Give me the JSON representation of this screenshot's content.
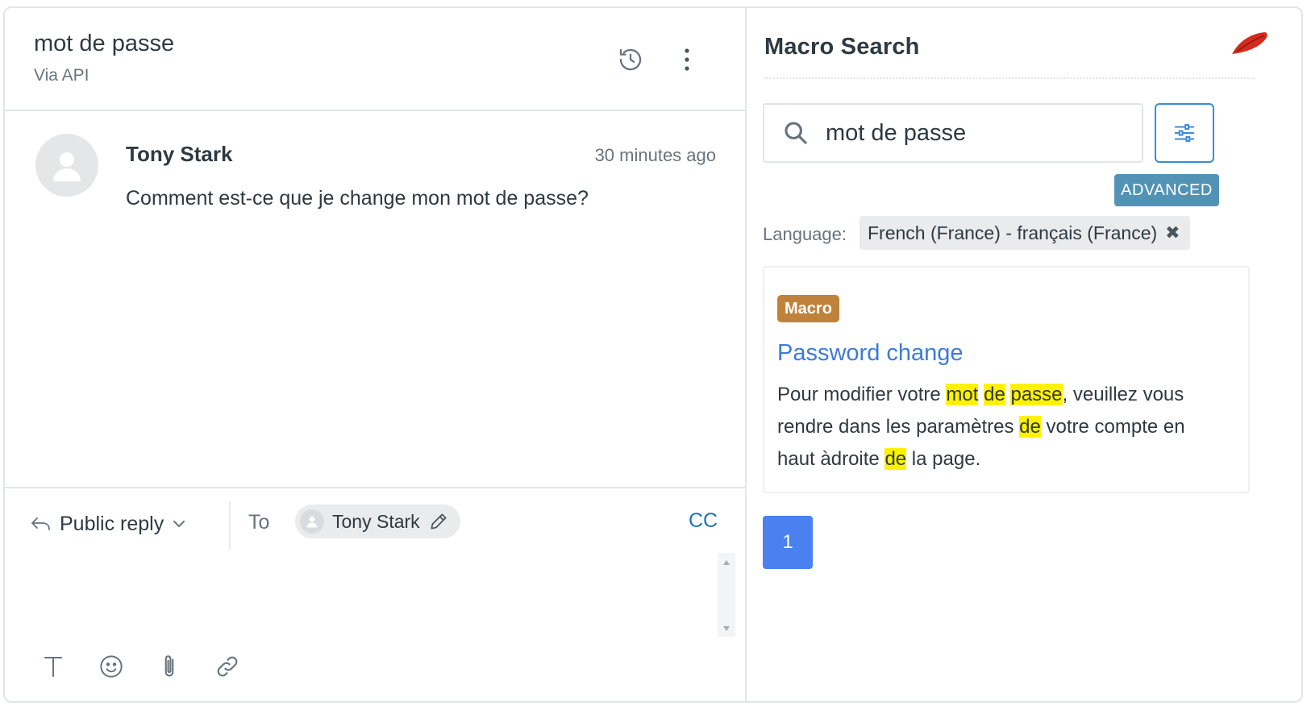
{
  "ticket": {
    "title": "mot de passe",
    "channel": "Via API",
    "message": {
      "author": "Tony Stark",
      "time": "30 minutes ago",
      "body": "Comment est-ce que je change mon mot de passe?"
    },
    "composer": {
      "reply_type": "Public reply",
      "to_label": "To",
      "recipient": "Tony Stark",
      "cc_label": "CC"
    }
  },
  "macro_search": {
    "title": "Macro Search",
    "query": "mot de passe",
    "advanced_label": "ADVANCED",
    "language_label": "Language:",
    "language_value": "French (France) - français (France)",
    "results": [
      {
        "type": "Macro",
        "title": "Password change",
        "snippet": [
          [
            "Pour modifier votre ",
            false
          ],
          [
            "mot",
            true
          ],
          [
            " ",
            false
          ],
          [
            "de",
            true
          ],
          [
            " ",
            false
          ],
          [
            "passe",
            true
          ],
          [
            ", veuillez vous rendre dans les paramètres ",
            false
          ],
          [
            "de",
            true
          ],
          [
            " votre compte en haut àdroite ",
            false
          ],
          [
            "de",
            true
          ],
          [
            " la page.",
            false
          ]
        ]
      }
    ],
    "pagination": {
      "current_page": "1"
    }
  },
  "colors": {
    "accent": "#3d7bd9",
    "page_button": "#4a80f0",
    "advanced_button": "#5293b5",
    "macro_badge": "#c0823a",
    "highlight": "#fff200"
  }
}
